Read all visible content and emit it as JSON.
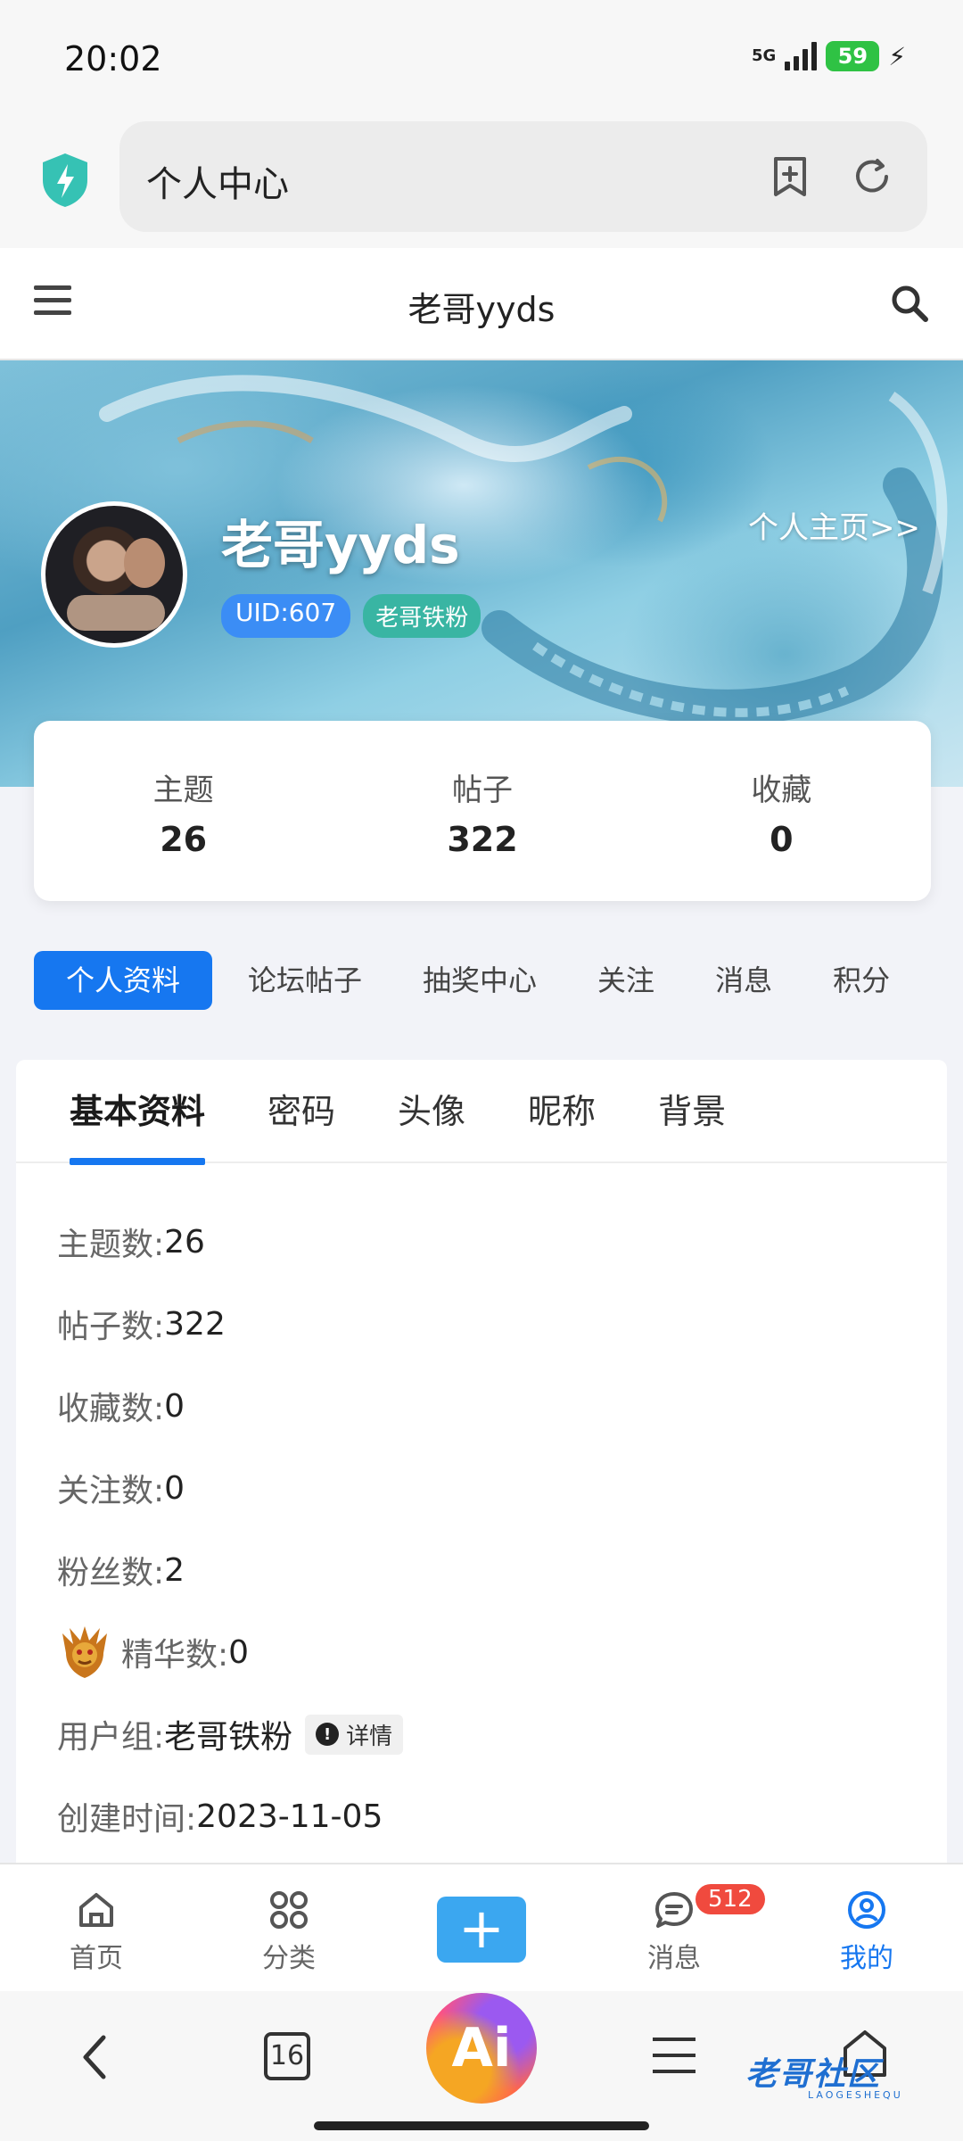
{
  "status_bar": {
    "time": "20:02",
    "network": "5G",
    "battery": "59"
  },
  "browser": {
    "url_text": "个人中心"
  },
  "site_header": {
    "title": "老哥yyds"
  },
  "profile": {
    "name": "老哥yyds",
    "homepage_link": "个人主页>>",
    "uid": "UID:607",
    "group_badge": "老哥铁粉"
  },
  "stats": [
    {
      "label": "主题",
      "value": "26"
    },
    {
      "label": "帖子",
      "value": "322"
    },
    {
      "label": "收藏",
      "value": "0"
    }
  ],
  "nav_tabs": [
    "个人资料",
    "论坛帖子",
    "抽奖中心",
    "关注",
    "消息",
    "积分"
  ],
  "sub_tabs": [
    "基本资料",
    "密码",
    "头像",
    "昵称",
    "背景"
  ],
  "info": {
    "topics_label": "主题数:",
    "topics_value": "26",
    "posts_label": "帖子数:",
    "posts_value": "322",
    "favorites_label": "收藏数:",
    "favorites_value": "0",
    "following_label": "关注数:",
    "following_value": "0",
    "fans_label": "粉丝数:",
    "fans_value": "2",
    "essence_label": "精华数:",
    "essence_value": "0",
    "group_label": "用户组:",
    "group_value": "老哥铁粉",
    "group_detail": "详情",
    "created_label": "创建时间:",
    "created_value": "2023-11-05"
  },
  "app_nav": {
    "home": "首页",
    "category": "分类",
    "add": "+",
    "messages": "消息",
    "messages_badge": "512",
    "mine": "我的"
  },
  "browser_nav": {
    "tab_count": "16",
    "ai_label": "Ai"
  },
  "watermark": {
    "text": "老哥社区",
    "sub": "LAOGESHEQU"
  },
  "colors": {
    "accent": "#1677f0",
    "badge_red": "#f04a3e",
    "plus_button": "#3ba7f0"
  }
}
